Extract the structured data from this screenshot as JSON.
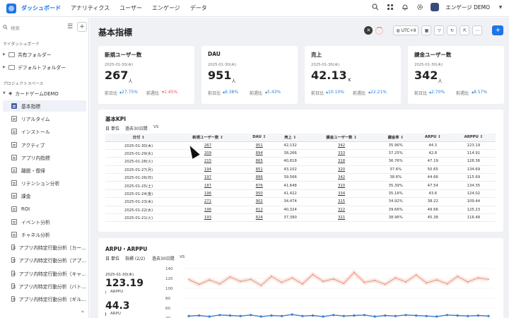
{
  "nav": {
    "tabs": [
      "ダッシュボード",
      "アナリティクス",
      "ユーザー",
      "エンゲージ",
      "データ"
    ],
    "workspace": "エンゲージ DEMO"
  },
  "sidebar": {
    "search_placeholder": "検索",
    "section_dashboard": "マイダッシュボード",
    "folders": [
      "共有フォルダー",
      "デフォルトフォルダー"
    ],
    "section_project": "プロジェクトスペース",
    "project": "カードゲームDEMO",
    "items": [
      {
        "label": "基本指標",
        "active": true
      },
      {
        "label": "リアルタイム"
      },
      {
        "label": "インストール"
      },
      {
        "label": "アクティブ"
      },
      {
        "label": "アプリ内指標"
      },
      {
        "label": "離脱・復帰"
      },
      {
        "label": "リテンション分析"
      },
      {
        "label": "課金"
      },
      {
        "label": "ROI"
      },
      {
        "label": "イベント分析"
      },
      {
        "label": "チャネル分析"
      },
      {
        "label": "アプリ内特定行動分析（カー…"
      },
      {
        "label": "アプリ内特定行動分析（アプ…"
      },
      {
        "label": "アプリ内特定行動分析（キャ…"
      },
      {
        "label": "アプリ内特定行動分析（バト…"
      },
      {
        "label": "アプリ内特定行動分析（ギル…"
      }
    ],
    "collapse": "«"
  },
  "page": {
    "title": "基本指標",
    "timezone": "UTC+9"
  },
  "cards": [
    {
      "title": "新規ユーザー数",
      "date": "2025-01-30(木)",
      "value": "267",
      "unit": "人",
      "dod_label": "前日比",
      "dod": "27.75%",
      "dod_dir": "up",
      "wow_label": "前週比",
      "wow": "1.45%",
      "wow_dir": "down"
    },
    {
      "title": "DAU",
      "date": "2025-01-30(木)",
      "value": "951",
      "unit": "人",
      "dod_label": "前日比",
      "dod": "6.38%",
      "dod_dir": "up",
      "wow_label": "前週比",
      "wow": "5.43%",
      "wow_dir": "up"
    },
    {
      "title": "売上",
      "date": "2025-01-30(木)",
      "value": "42.13",
      "unit": "K",
      "dod_label": "前日比",
      "dod": "10.10%",
      "dod_dir": "up",
      "wow_label": "前週比",
      "wow": "22.21%",
      "wow_dir": "up"
    },
    {
      "title": "課金ユーザー数",
      "date": "2025-01-30(木)",
      "value": "342",
      "unit": "人",
      "dod_label": "前日比",
      "dod": "2.70%",
      "dod_dir": "up",
      "wow_label": "前週比",
      "wow": "8.57%",
      "wow_dir": "up"
    }
  ],
  "kpi": {
    "title": "基本KPI",
    "unit_label": "日 単位",
    "range": "過去30日間",
    "vs": "VS",
    "headers": [
      "日付 ↕",
      "新規ユーザー数 ↕",
      "DAU ↕",
      "売上 ↕",
      "課金ユーザー数 ↕",
      "課金率 ↕",
      "ARPU ↕",
      "ARPPU ↕"
    ],
    "rows": [
      [
        "2025-01-30(木)",
        "267",
        "951",
        "42,132",
        "342",
        "35.96%",
        "44.3",
        "123.19"
      ],
      [
        "2025-01-29(水)",
        "209",
        "894",
        "38,266",
        "333",
        "37.25%",
        "42.8",
        "114.91"
      ],
      [
        "2025-01-28(火)",
        "215",
        "865",
        "40,818",
        "318",
        "36.76%",
        "47.19",
        "128.36"
      ],
      [
        "2025-01-27(月)",
        "194",
        "851",
        "43,102",
        "320",
        "37.6%",
        "50.65",
        "134.69"
      ],
      [
        "2025-01-26(日)",
        "197",
        "886",
        "39,566",
        "342",
        "38.6%",
        "44.66",
        "115.69"
      ],
      [
        "2025-01-25(土)",
        "187",
        "876",
        "41,648",
        "310",
        "35.39%",
        "47.54",
        "134.35"
      ],
      [
        "2025-01-24(金)",
        "196",
        "950",
        "41,422",
        "334",
        "35.16%",
        "43.6",
        "124.02"
      ],
      [
        "2025-01-23(木)",
        "271",
        "902",
        "34,474",
        "315",
        "34.92%",
        "38.22",
        "109.44"
      ],
      [
        "2025-01-22(水)",
        "196",
        "812",
        "40,324",
        "322",
        "39.66%",
        "49.66",
        "125.23"
      ],
      [
        "2025-01-21(火)",
        "193",
        "824",
        "37,390",
        "321",
        "38.96%",
        "45.38",
        "116.48"
      ]
    ]
  },
  "arpu": {
    "title": "ARPU・ARPPU",
    "unit_label": "日 単位",
    "metric_label": "指標 (2/2)",
    "range": "過去30日間",
    "vs": "VS",
    "date": "2025-01-30(木)",
    "big1": "123.19",
    "big1_label": "ARPPU",
    "big2": "44.3",
    "big2_label": "ARPU",
    "colors": {
      "arppu": "#e8846c",
      "arpu": "#3d7cc9"
    }
  },
  "chart_data": {
    "type": "line",
    "ylim": [
      40,
      140
    ],
    "yticks": [
      140,
      120,
      100,
      80,
      60,
      40
    ],
    "series": [
      {
        "name": "ARPPU",
        "values": [
          118,
          108,
          117,
          109,
          123,
          114,
          118,
          106,
          124,
          112,
          121,
          109,
          128,
          114,
          119,
          110,
          132,
          112,
          116,
          108,
          121,
          113,
          127,
          111,
          117,
          109,
          124,
          113,
          121,
          118
        ]
      },
      {
        "name": "ARPU",
        "values": [
          44,
          45,
          43,
          46,
          45,
          44,
          46,
          43,
          45,
          44,
          47,
          44,
          45,
          43,
          46,
          44,
          45,
          46,
          43,
          45,
          44,
          46,
          45,
          44,
          43,
          46,
          45,
          44,
          45,
          44
        ]
      }
    ]
  }
}
